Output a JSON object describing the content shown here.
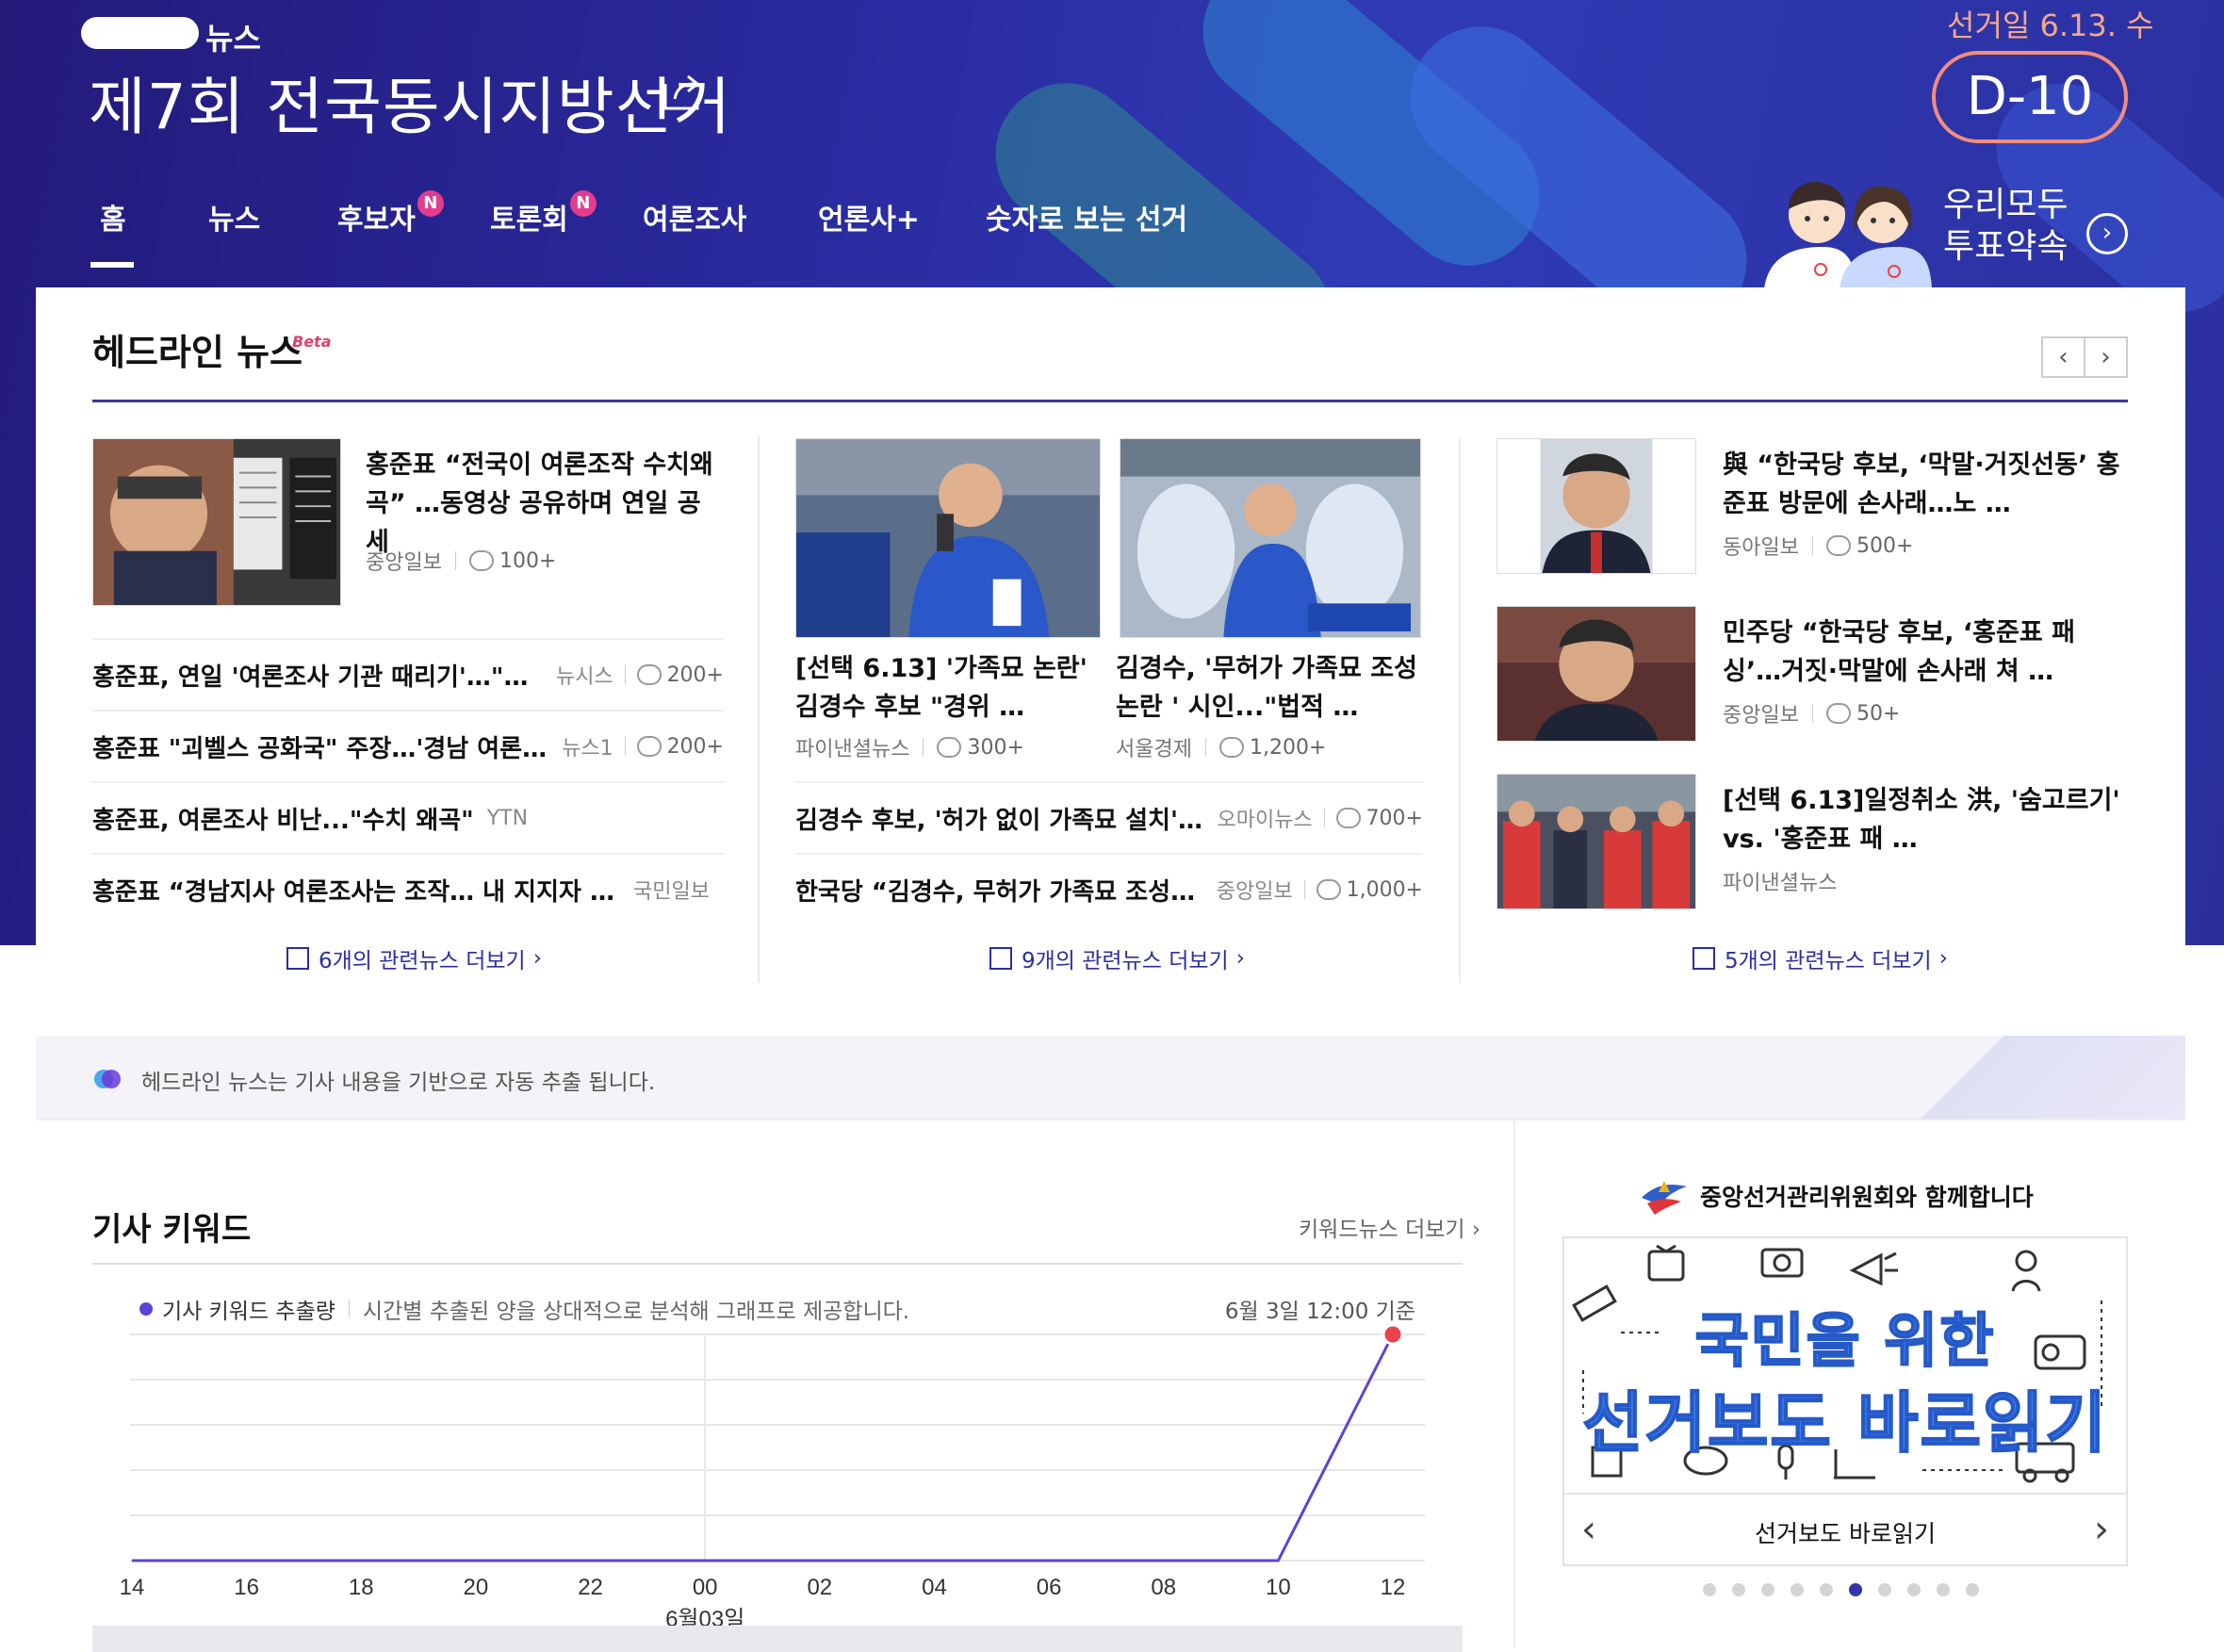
{
  "header": {
    "news_tag": "뉴스",
    "title": "제7회 전국동시지방선거",
    "election_date": "선거일 6.13. 수",
    "dday": "D-10",
    "vote_promise_line1": "우리모두",
    "vote_promise_line2": "투표약속"
  },
  "nav": {
    "items": [
      {
        "label": "홈",
        "badge": ""
      },
      {
        "label": "뉴스",
        "badge": ""
      },
      {
        "label": "후보자",
        "badge": "N"
      },
      {
        "label": "토론회",
        "badge": "N"
      },
      {
        "label": "여론조사",
        "badge": ""
      },
      {
        "label": "언론사+",
        "badge": ""
      },
      {
        "label": "숫자로 보는 선거",
        "badge": ""
      }
    ]
  },
  "headline_news": {
    "title": "헤드라인 뉴스",
    "beta": "Beta",
    "col1": {
      "main": {
        "title": "홍준표 “전국이 여론조작 수치왜곡” …동영상 공유하며 연일 공세",
        "source": "중앙일보",
        "comments": "100+"
      },
      "rows": [
        {
          "title": "홍준표, 연일 '여론조사 기관 때리기'…\"전국서 …",
          "source": "뉴시스",
          "comments": "200+"
        },
        {
          "title": "홍준표 \"괴벨스 공화국\" 주장…'경남 여론조사' …",
          "source": "뉴스1",
          "comments": "200+"
        },
        {
          "title": "홍준표, 여론조사 비난...\"수치 왜곡\"",
          "source": "YTN",
          "comments": ""
        },
        {
          "title": "홍준표 “경남지사 여론조사는 조작… 내 지지자 절반만 …",
          "source": "국민일보",
          "comments": ""
        }
      ],
      "more": "6개의 관련뉴스 더보기"
    },
    "col2": {
      "cards": [
        {
          "title": "[선택 6.13] '가족묘 논란' 김경수 후보 \"경위 …",
          "source": "파이낸셜뉴스",
          "comments": "300+"
        },
        {
          "title": "김경수, '무허가 가족묘 조성 논란 ' 시인...\"법적 …",
          "source": "서울경제",
          "comments": "1,200+"
        }
      ],
      "rows": [
        {
          "title": "김경수 후보, '허가 없이 가족묘 설치'에 사과",
          "source": "오마이뉴스",
          "comments": "700+"
        },
        {
          "title": "한국당 “김경수, 무허가 가족묘 조성 사죄해…",
          "source": "중앙일보",
          "comments": "1,000+"
        }
      ],
      "more": "9개의 관련뉴스 더보기"
    },
    "col3": {
      "items": [
        {
          "title": "與 “한국당 후보, ‘막말·거짓선동’ 홍준표 방문에 손사래…노 …",
          "source": "동아일보",
          "comments": "500+"
        },
        {
          "title": "민주당 “한국당 후보, ‘홍준표 패싱’…거짓·막말에 손사래 쳐 …",
          "source": "중앙일보",
          "comments": "50+"
        },
        {
          "title": "[선택 6.13]일정취소 洪, '숨고르기' vs. '홍준표 패 …",
          "source": "파이낸셜뉴스",
          "comments": ""
        }
      ],
      "more": "5개의 관련뉴스 더보기"
    },
    "notice": "헤드라인 뉴스는 기사 내용을 기반으로 자동 추출 됩니다."
  },
  "keywords": {
    "title": "기사 키워드",
    "more": "키워드뉴스 더보기",
    "legend": "기사 키워드 추출량",
    "description": "시간별 추출된 양을 상대적으로 분석해 그래프로 제공합니다.",
    "timestamp": "6월 3일 12:00 기준"
  },
  "chart_data": {
    "type": "line",
    "x": [
      "14",
      "16",
      "18",
      "20",
      "22",
      "00",
      "02",
      "04",
      "06",
      "08",
      "10",
      "12"
    ],
    "x_sublabel": {
      "at": "00",
      "text": "6월03일"
    },
    "series": [
      {
        "name": "기사 키워드 추출량",
        "values": [
          0,
          0,
          0,
          0,
          0,
          0,
          0,
          0,
          0,
          0,
          0,
          100
        ]
      }
    ],
    "ylim": [
      0,
      100
    ],
    "grid": true,
    "colors": {
      "line": "#5a44d8",
      "marker": "#e9424c"
    }
  },
  "nec": {
    "title": "중앙선거관리위원회와 함께합니다",
    "banner_line1": "국민을 위한",
    "banner_line2": "선거보도 바로읽기",
    "caption": "선거보도 바로읽기",
    "dots_total": 10,
    "dots_active": 6
  },
  "colors": {
    "header_bg": "#2a2a9e",
    "accent": "#2b2fa0",
    "badge": "#e33c8e",
    "dday_border": "#f28d7e"
  }
}
